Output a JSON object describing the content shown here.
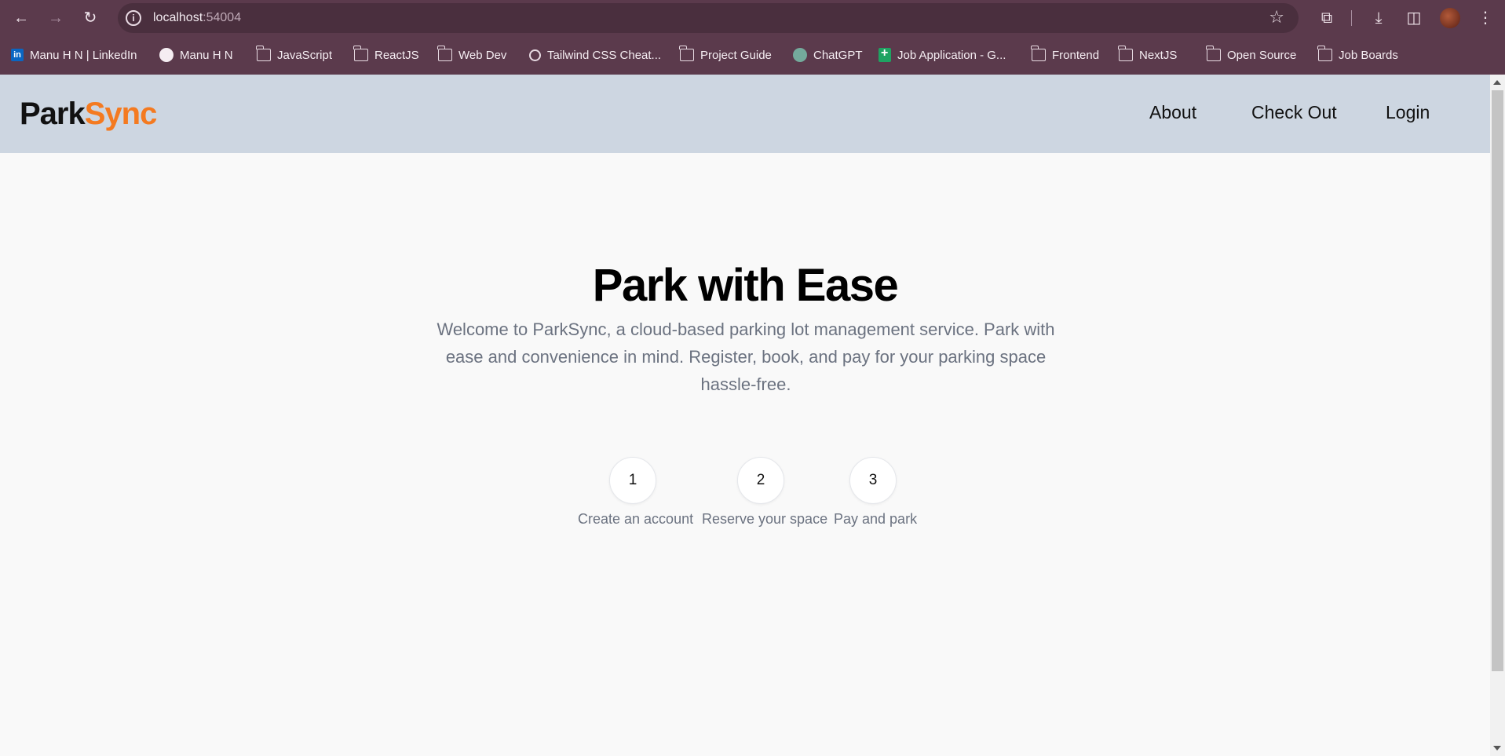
{
  "browser": {
    "url_host": "localhost",
    "url_port": ":54004",
    "bookmarks": [
      {
        "label": "Manu H N | LinkedIn",
        "icon": "linkedin-icon"
      },
      {
        "label": "Manu H N",
        "icon": "github-icon"
      },
      {
        "label": "JavaScript",
        "icon": "folder-icon"
      },
      {
        "label": "ReactJS",
        "icon": "folder-icon"
      },
      {
        "label": "Web Dev",
        "icon": "folder-icon"
      },
      {
        "label": "Tailwind CSS Cheat...",
        "icon": "search-icon"
      },
      {
        "label": "Project Guide",
        "icon": "folder-icon"
      },
      {
        "label": "ChatGPT",
        "icon": "chatgpt-icon"
      },
      {
        "label": "Job Application - G...",
        "icon": "sheets-icon"
      },
      {
        "label": "Frontend",
        "icon": "folder-icon"
      },
      {
        "label": "NextJS",
        "icon": "folder-icon"
      },
      {
        "label": "Open Source",
        "icon": "folder-icon"
      },
      {
        "label": "Job Boards",
        "icon": "folder-icon"
      }
    ]
  },
  "header": {
    "logo_part1": "Park",
    "logo_part2": "Sync",
    "nav": [
      {
        "label": "About"
      },
      {
        "label": "Check Out"
      },
      {
        "label": "Login"
      }
    ]
  },
  "hero": {
    "title": "Park with Ease",
    "subtitle": "Welcome to ParkSync, a cloud-based parking lot management service. Park with ease and convenience in mind. Register, book, and pay for your parking space hassle-free."
  },
  "steps": [
    {
      "number": "1",
      "label": "Create an account"
    },
    {
      "number": "2",
      "label": "Reserve your space"
    },
    {
      "number": "3",
      "label": "Pay and park"
    }
  ],
  "colors": {
    "chrome": "#5b3a4c",
    "header_bg": "#cdd6e1",
    "brand_accent": "#f47a20"
  }
}
